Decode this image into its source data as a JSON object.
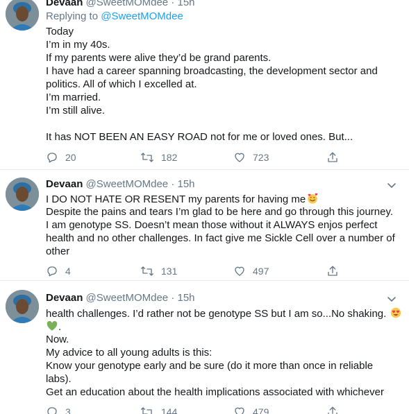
{
  "tweets": [
    {
      "name": "Devaan",
      "handle": "@SweetMOMdee",
      "separator": "·",
      "time": "15h",
      "replying_prefix": "Replying to",
      "replying_to": "@SweetMOMdee",
      "lines": [
        "Today",
        "I’m in my 40s.",
        "If my parents were alive they’d be grand parents.",
        "I have had a career spanning broadcasting, the development sector and",
        "politics. All of which I excelled at.",
        "I’m married.",
        "I’m still alive.",
        "",
        "It has NOT BEEN AN EASY ROAD not for me or loved ones. But..."
      ],
      "replies": "20",
      "retweets": "182",
      "likes": "723"
    },
    {
      "name": "Devaan",
      "handle": "@SweetMOMdee",
      "separator": "·",
      "time": "15h",
      "lines": [
        "I DO NOT HATE OR RESENT my parents for having me",
        "Despite the pains and tears I’m glad to be here and go through this journey.",
        "I am genotype SS. Doesn’t mean those without it ALWAYS enjos perfect",
        "health and no other challenges. In fact give me Sickle Cell over a number of",
        "other"
      ],
      "line_emoji": "smiling-face-with-hearts",
      "replies": "4",
      "retweets": "131",
      "likes": "497"
    },
    {
      "name": "Devaan",
      "handle": "@SweetMOMdee",
      "separator": "·",
      "time": "15h",
      "lines": [
        "health challenges. I’d rather not be genotype SS but I am so...No shaking.",
        ".",
        "Now.",
        "My advice to all young adults is this:",
        "Know your genotype early and be sure (do it more than once in reliable",
        "labs).",
        "Get an education about the health implications associated with whichever"
      ],
      "line_emoji_1": "heart-eyes",
      "line_emoji_2": "green-heart",
      "replies": "3",
      "retweets": "144",
      "likes": "479"
    }
  ],
  "colors": {
    "text": "#14171a",
    "muted": "#657786",
    "link": "#1da1f2",
    "divider": "#e6ecf0"
  },
  "icons": [
    "reply-icon",
    "retweet-icon",
    "like-icon",
    "share-icon",
    "chevron-down-icon"
  ]
}
